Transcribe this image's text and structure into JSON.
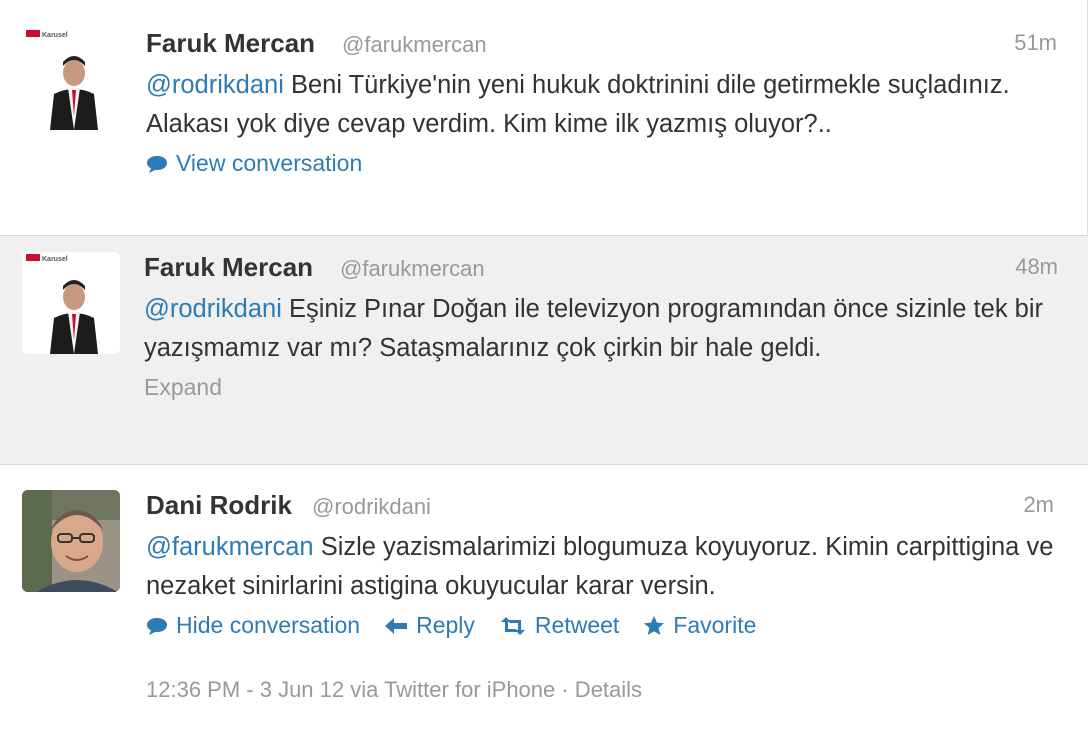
{
  "tweets": [
    {
      "name": "Faruk Mercan",
      "handle": "@farukmercan",
      "time": "51m",
      "mention": "@rodrikdani",
      "text": " Beni Türkiye'nin yeni hukuk doktrinini dile getirmekle suçladınız. Alakası yok diye cevap verdim. Kim kime ilk yazmış oluyor?..",
      "action_label": "View conversation",
      "avatar_logo_text": "Karusel"
    },
    {
      "name": "Faruk Mercan",
      "handle": "@farukmercan",
      "time": "48m",
      "mention": "@rodrikdani",
      "text": " Eşiniz Pınar Doğan ile televizyon programından önce sizinle tek bir yazışmamız var mı? Sataşmalarınız çok çirkin bir hale geldi.",
      "expand_label": "Expand",
      "avatar_logo_text": "Karusel"
    },
    {
      "name": "Dani Rodrik",
      "handle": "@rodrikdani",
      "time": "2m",
      "mention": "@farukmercan",
      "text": " Sizle yazismalarimizi blogumuza koyuyoruz. Kimin carpittigina ve nezaket sinirlarini astigina okuyucular karar versin.",
      "actions": {
        "hide": "Hide conversation",
        "reply": "Reply",
        "retweet": "Retweet",
        "favorite": "Favorite"
      },
      "meta": "12:36 PM - 3 Jun 12 via Twitter for iPhone · Details"
    }
  ],
  "colors": {
    "link": "#2f7bb4",
    "muted": "#999999",
    "text": "#333333",
    "highlight_bg": "#f0f0f0"
  },
  "icons": [
    "speech-bubble-icon",
    "reply-arrow-icon",
    "retweet-icon",
    "star-icon"
  ]
}
